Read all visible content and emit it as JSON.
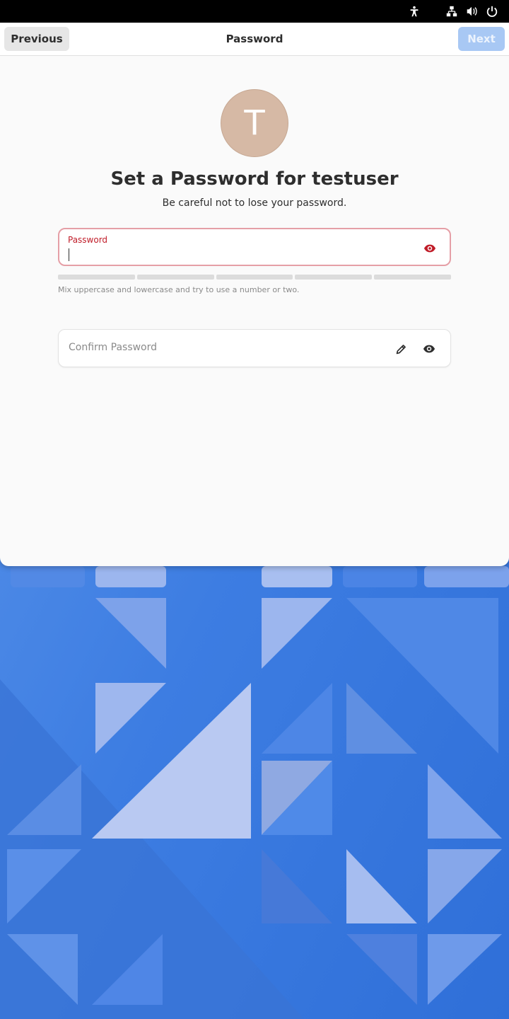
{
  "topbar": {
    "icons": [
      "accessibility-icon",
      "network-icon",
      "volume-icon",
      "power-icon"
    ]
  },
  "window": {
    "title": "Password",
    "previous_label": "Previous",
    "next_label": "Next",
    "next_enabled": false
  },
  "avatar": {
    "initial": "T",
    "color": "#d6b9a5"
  },
  "heading": "Set a Password for testuser",
  "subtitle": "Be careful not to lose your password.",
  "password": {
    "label": "Password",
    "value": "",
    "hint": "Mix uppercase and lowercase and try to use a number or two.",
    "strength_level": 0,
    "error_color": "#c01c28"
  },
  "confirm": {
    "placeholder": "Confirm Password",
    "value": ""
  },
  "colors": {
    "accent_disabled": "#a8c8f4",
    "wallpaper": "#3f7fe0"
  }
}
